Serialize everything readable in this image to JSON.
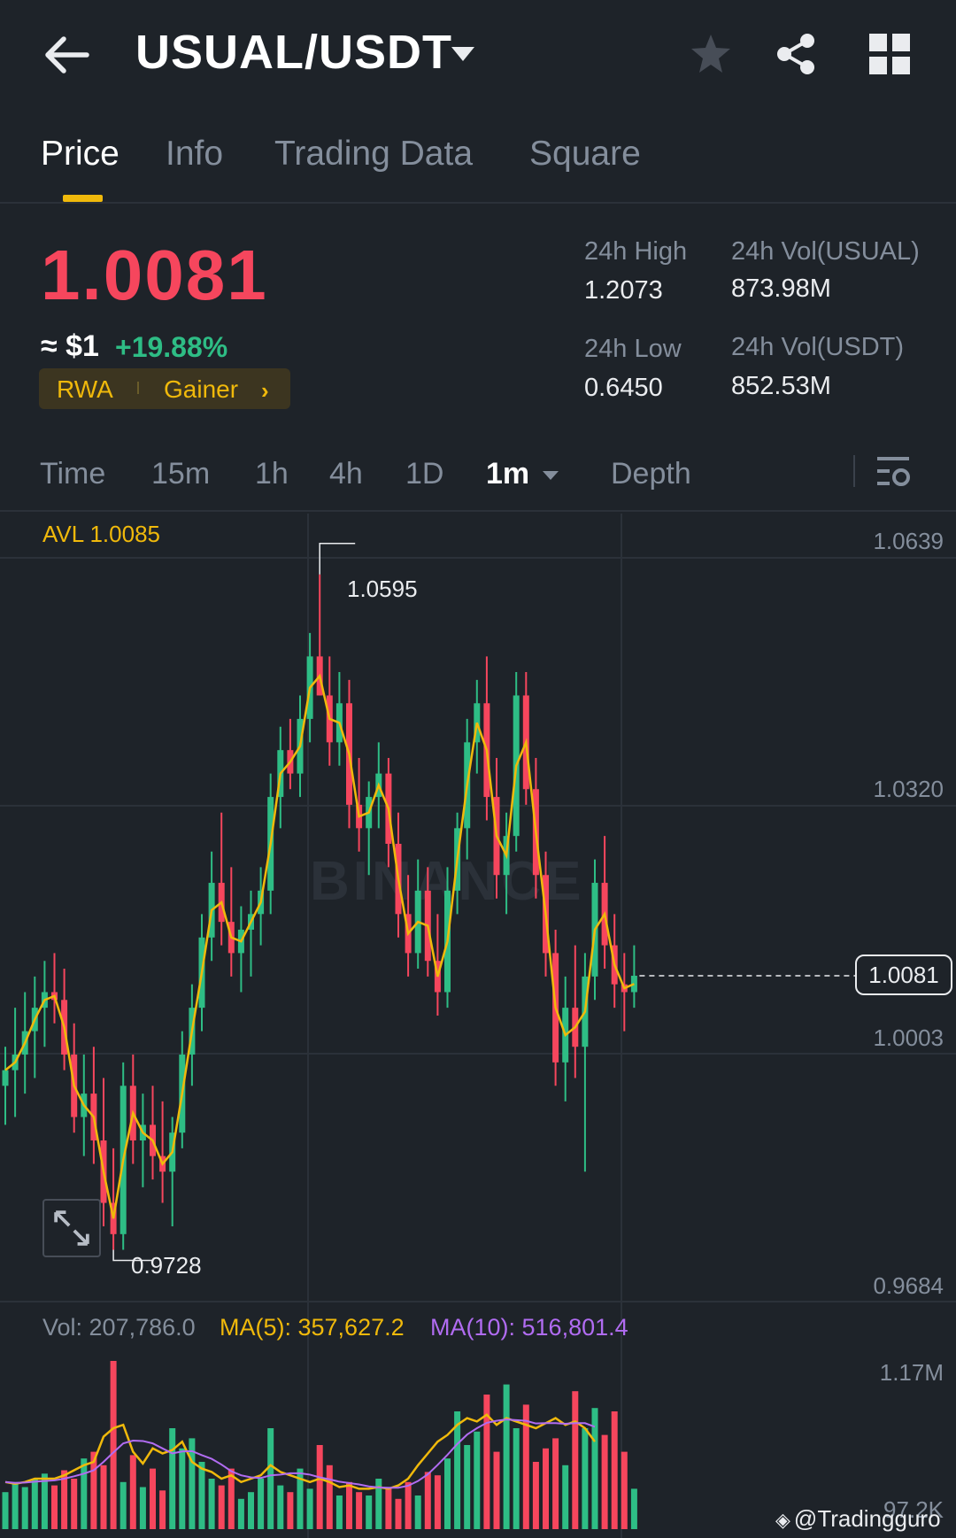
{
  "header": {
    "pair": "USUAL/USDT"
  },
  "tabs": [
    "Price",
    "Info",
    "Trading Data",
    "Square"
  ],
  "ticker": {
    "last_price": "1.0081",
    "usd_approx": "≈ $1",
    "change_pct": "+19.88%",
    "tags": [
      "RWA",
      "Gainer"
    ],
    "high_label": "24h High",
    "high_value": "1.2073",
    "low_label": "24h Low",
    "low_value": "0.6450",
    "vol_base_label": "24h Vol(USUAL)",
    "vol_base_value": "873.98M",
    "vol_quote_label": "24h Vol(USDT)",
    "vol_quote_value": "852.53M"
  },
  "timebar": {
    "items": [
      "Time",
      "15m",
      "1h",
      "4h",
      "1D",
      "1m",
      "Depth"
    ],
    "selected": "1m"
  },
  "chart": {
    "avl": "AVL 1.0085",
    "y_ticks": [
      "1.0639",
      "1.0320",
      "1.0003",
      "0.9684"
    ],
    "high_marker": "1.0595",
    "low_marker": "0.9728",
    "current_price_label": "1.0081",
    "watermark": "BINANCE"
  },
  "volume": {
    "vol": "Vol: 207,786.0",
    "ma5": "MA(5): 357,627.2",
    "ma10": "MA(10): 516,801.4",
    "y_ticks": [
      "1.17M",
      "97.2K"
    ]
  },
  "colors": {
    "up": "#2ebd85",
    "down": "#f6465d",
    "accent": "#f0b90b",
    "ma10": "#b16cf2",
    "bg": "#1e2329"
  },
  "credit": "@Tradingguro",
  "chart_data": {
    "type": "candlestick",
    "interval": "1m",
    "ylim": [
      0.9684,
      1.0639
    ],
    "y_ticks": [
      1.0639,
      1.032,
      1.0003,
      0.9684
    ],
    "candles": [
      {
        "o": 0.994,
        "h": 0.999,
        "l": 0.989,
        "c": 0.996
      },
      {
        "o": 0.996,
        "h": 1.004,
        "l": 0.99,
        "c": 0.998
      },
      {
        "o": 0.998,
        "h": 1.006,
        "l": 0.993,
        "c": 1.001
      },
      {
        "o": 1.001,
        "h": 1.008,
        "l": 0.995,
        "c": 1.004
      },
      {
        "o": 1.004,
        "h": 1.01,
        "l": 0.999,
        "c": 1.006
      },
      {
        "o": 1.006,
        "h": 1.011,
        "l": 1.002,
        "c": 1.005
      },
      {
        "o": 1.005,
        "h": 1.009,
        "l": 0.996,
        "c": 0.998
      },
      {
        "o": 0.998,
        "h": 1.002,
        "l": 0.988,
        "c": 0.99
      },
      {
        "o": 0.99,
        "h": 0.998,
        "l": 0.985,
        "c": 0.993
      },
      {
        "o": 0.993,
        "h": 0.999,
        "l": 0.984,
        "c": 0.987
      },
      {
        "o": 0.987,
        "h": 0.995,
        "l": 0.976,
        "c": 0.979
      },
      {
        "o": 0.979,
        "h": 0.986,
        "l": 0.973,
        "c": 0.975
      },
      {
        "o": 0.975,
        "h": 0.997,
        "l": 0.973,
        "c": 0.994
      },
      {
        "o": 0.994,
        "h": 0.998,
        "l": 0.984,
        "c": 0.987
      },
      {
        "o": 0.987,
        "h": 0.993,
        "l": 0.981,
        "c": 0.989
      },
      {
        "o": 0.989,
        "h": 0.994,
        "l": 0.982,
        "c": 0.985
      },
      {
        "o": 0.985,
        "h": 0.992,
        "l": 0.979,
        "c": 0.983
      },
      {
        "o": 0.983,
        "h": 0.99,
        "l": 0.976,
        "c": 0.988
      },
      {
        "o": 0.988,
        "h": 1.001,
        "l": 0.986,
        "c": 0.998
      },
      {
        "o": 0.998,
        "h": 1.007,
        "l": 0.994,
        "c": 1.004
      },
      {
        "o": 1.004,
        "h": 1.016,
        "l": 1.001,
        "c": 1.013
      },
      {
        "o": 1.013,
        "h": 1.024,
        "l": 1.01,
        "c": 1.02
      },
      {
        "o": 1.02,
        "h": 1.029,
        "l": 1.012,
        "c": 1.015
      },
      {
        "o": 1.015,
        "h": 1.022,
        "l": 1.008,
        "c": 1.011
      },
      {
        "o": 1.011,
        "h": 1.017,
        "l": 1.006,
        "c": 1.014
      },
      {
        "o": 1.014,
        "h": 1.019,
        "l": 1.008,
        "c": 1.016
      },
      {
        "o": 1.016,
        "h": 1.022,
        "l": 1.012,
        "c": 1.019
      },
      {
        "o": 1.019,
        "h": 1.034,
        "l": 1.016,
        "c": 1.031
      },
      {
        "o": 1.031,
        "h": 1.04,
        "l": 1.027,
        "c": 1.037
      },
      {
        "o": 1.037,
        "h": 1.041,
        "l": 1.032,
        "c": 1.034
      },
      {
        "o": 1.034,
        "h": 1.044,
        "l": 1.031,
        "c": 1.041
      },
      {
        "o": 1.041,
        "h": 1.052,
        "l": 1.038,
        "c": 1.049
      },
      {
        "o": 1.049,
        "h": 1.0595,
        "l": 1.044,
        "c": 1.044
      },
      {
        "o": 1.044,
        "h": 1.049,
        "l": 1.035,
        "c": 1.038
      },
      {
        "o": 1.038,
        "h": 1.047,
        "l": 1.035,
        "c": 1.043
      },
      {
        "o": 1.043,
        "h": 1.046,
        "l": 1.027,
        "c": 1.03
      },
      {
        "o": 1.03,
        "h": 1.036,
        "l": 1.024,
        "c": 1.027
      },
      {
        "o": 1.027,
        "h": 1.033,
        "l": 1.021,
        "c": 1.031
      },
      {
        "o": 1.031,
        "h": 1.038,
        "l": 1.027,
        "c": 1.034
      },
      {
        "o": 1.034,
        "h": 1.036,
        "l": 1.022,
        "c": 1.025
      },
      {
        "o": 1.025,
        "h": 1.029,
        "l": 1.013,
        "c": 1.016
      },
      {
        "o": 1.016,
        "h": 1.021,
        "l": 1.008,
        "c": 1.011
      },
      {
        "o": 1.011,
        "h": 1.023,
        "l": 1.009,
        "c": 1.019
      },
      {
        "o": 1.019,
        "h": 1.022,
        "l": 1.008,
        "c": 1.01
      },
      {
        "o": 1.01,
        "h": 1.016,
        "l": 1.003,
        "c": 1.006
      },
      {
        "o": 1.006,
        "h": 1.022,
        "l": 1.004,
        "c": 1.019
      },
      {
        "o": 1.019,
        "h": 1.029,
        "l": 1.016,
        "c": 1.027
      },
      {
        "o": 1.027,
        "h": 1.041,
        "l": 1.023,
        "c": 1.038
      },
      {
        "o": 1.038,
        "h": 1.046,
        "l": 1.034,
        "c": 1.043
      },
      {
        "o": 1.043,
        "h": 1.049,
        "l": 1.028,
        "c": 1.031
      },
      {
        "o": 1.031,
        "h": 1.036,
        "l": 1.018,
        "c": 1.021
      },
      {
        "o": 1.021,
        "h": 1.029,
        "l": 1.016,
        "c": 1.026
      },
      {
        "o": 1.026,
        "h": 1.047,
        "l": 1.024,
        "c": 1.044
      },
      {
        "o": 1.044,
        "h": 1.047,
        "l": 1.03,
        "c": 1.032
      },
      {
        "o": 1.032,
        "h": 1.036,
        "l": 1.018,
        "c": 1.021
      },
      {
        "o": 1.021,
        "h": 1.024,
        "l": 1.008,
        "c": 1.011
      },
      {
        "o": 1.011,
        "h": 1.014,
        "l": 0.994,
        "c": 0.997
      },
      {
        "o": 0.997,
        "h": 1.008,
        "l": 0.992,
        "c": 1.004
      },
      {
        "o": 1.004,
        "h": 1.012,
        "l": 0.995,
        "c": 0.999
      },
      {
        "o": 0.999,
        "h": 1.011,
        "l": 0.983,
        "c": 1.008
      },
      {
        "o": 1.008,
        "h": 1.023,
        "l": 1.005,
        "c": 1.02
      },
      {
        "o": 1.02,
        "h": 1.026,
        "l": 1.009,
        "c": 1.012
      },
      {
        "o": 1.012,
        "h": 1.016,
        "l": 1.004,
        "c": 1.007
      },
      {
        "o": 1.007,
        "h": 1.011,
        "l": 1.001,
        "c": 1.006
      },
      {
        "o": 1.006,
        "h": 1.012,
        "l": 1.004,
        "c": 1.0081
      }
    ],
    "volume": [
      0.22,
      0.28,
      0.25,
      0.3,
      0.33,
      0.26,
      0.35,
      0.3,
      0.42,
      0.46,
      0.38,
      1.0,
      0.28,
      0.44,
      0.25,
      0.36,
      0.23,
      0.6,
      0.48,
      0.54,
      0.4,
      0.3,
      0.26,
      0.36,
      0.18,
      0.22,
      0.3,
      0.6,
      0.26,
      0.22,
      0.36,
      0.24,
      0.5,
      0.38,
      0.2,
      0.28,
      0.22,
      0.2,
      0.3,
      0.24,
      0.18,
      0.28,
      0.2,
      0.34,
      0.32,
      0.42,
      0.7,
      0.5,
      0.58,
      0.8,
      0.46,
      0.86,
      0.6,
      0.74,
      0.4,
      0.48,
      0.54,
      0.38,
      0.82,
      0.6,
      0.72,
      0.56,
      0.7,
      0.46,
      0.24
    ],
    "vol_ma5": [
      0.28,
      0.27,
      0.28,
      0.3,
      0.3,
      0.3,
      0.32,
      0.35,
      0.38,
      0.4,
      0.55,
      0.6,
      0.62,
      0.46,
      0.39,
      0.48,
      0.45,
      0.47,
      0.52,
      0.4,
      0.36,
      0.34,
      0.3,
      0.32,
      0.28,
      0.3,
      0.32,
      0.38,
      0.34,
      0.32,
      0.3,
      0.28,
      0.3,
      0.28,
      0.25,
      0.26,
      0.24,
      0.24,
      0.25,
      0.24,
      0.26,
      0.3,
      0.38,
      0.45,
      0.52,
      0.56,
      0.62,
      0.66,
      0.64,
      0.68,
      0.62,
      0.66,
      0.64,
      0.62,
      0.6,
      0.63,
      0.66,
      0.62,
      0.64,
      0.6,
      0.52
    ]
  }
}
